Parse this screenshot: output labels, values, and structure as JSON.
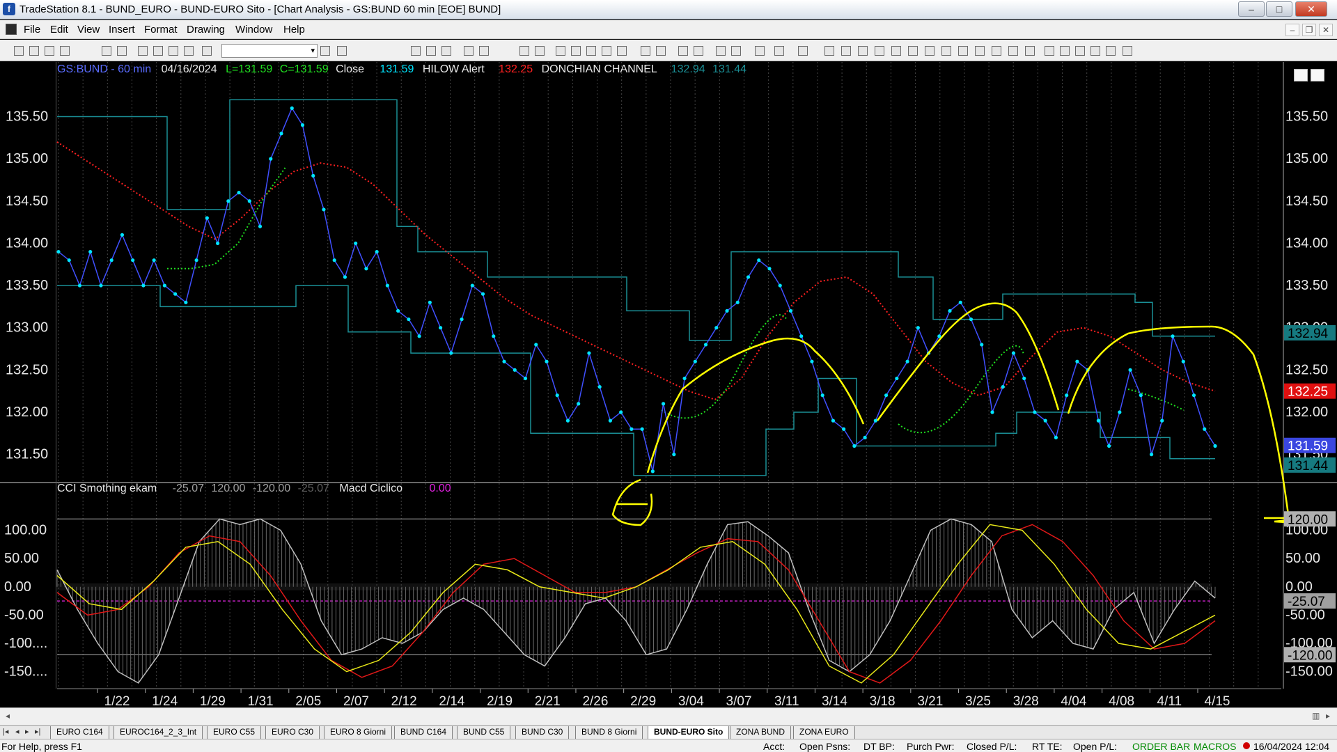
{
  "window": {
    "title": "TradeStation 8.1 - BUND_EURO - BUND-EURO Sito - [Chart Analysis - GS:BUND  60 min  [EOE] BUND]",
    "app_icon_letter": "f",
    "minimize": "–",
    "maximize": "□",
    "close": "✕"
  },
  "menu": {
    "items": [
      "File",
      "Edit",
      "View",
      "Insert",
      "Format",
      "Drawing",
      "Window",
      "Help"
    ],
    "mdi_minimize": "–",
    "mdi_restore": "❐",
    "mdi_close": "✕"
  },
  "toolbar": {
    "symbol_value": "",
    "dropdown_arrow": "▾"
  },
  "status_line": {
    "symbol": "GS:BUND - 60 min",
    "date": "04/16/2024",
    "low": "L=131.59",
    "close_val": "C=131.59",
    "close_label": "Close",
    "close_price": "131.59",
    "hilow_label": "HILOW Alert",
    "hilow_value": "132.25",
    "donchian_label": "DONCHIAN CHANNEL",
    "donchian_upper": "132.94",
    "donchian_lower": "131.44"
  },
  "sub_status": {
    "cci_label": "CCI Smothing ekam",
    "cci_value": "-25.07",
    "cci_upper": "120.00",
    "cci_lower": "-120.00",
    "cci_value2": "-25.07",
    "macd_label": "Macd Ciclico",
    "macd_value": "0.00"
  },
  "colors": {
    "price": "#00e5ff",
    "bar_line": "#4050ff",
    "sma": "#ff2020",
    "green_avg": "#20e020",
    "donchian": "#1a8f96",
    "drawing": "#ffff00",
    "cci": "#c0c0c0",
    "macd_red": "#e01818",
    "macd_yellow": "#e8e818"
  },
  "chart_data": [
    {
      "type": "line",
      "title": "",
      "y_ticks": [
        135.5,
        135.0,
        134.5,
        134.0,
        133.5,
        133.0,
        132.5,
        132.0,
        131.5
      ],
      "x_ticks": [
        "1/22",
        "1/24",
        "1/29",
        "1/31",
        "2/05",
        "2/07",
        "2/12",
        "2/14",
        "2/19",
        "2/21",
        "2/26",
        "2/29",
        "3/04",
        "3/07",
        "3/11",
        "3/14",
        "3/18",
        "3/21",
        "3/25",
        "3/28",
        "4/04",
        "4/08",
        "4/11",
        "4/15"
      ],
      "ylim": [
        131.2,
        135.9
      ],
      "series": [
        {
          "values": [
            133.9,
            133.8,
            133.5,
            133.9,
            133.5,
            133.8,
            134.1,
            133.8,
            133.5,
            133.8,
            133.5,
            133.4,
            133.3,
            133.8,
            134.3,
            134.0,
            134.5,
            134.6,
            134.5,
            134.2,
            135.0,
            135.3,
            135.6,
            135.4,
            134.8,
            134.4,
            133.8,
            133.6,
            134.0,
            133.7,
            133.9,
            133.5,
            133.2,
            133.1,
            132.9,
            133.3,
            133.0,
            132.7,
            133.1,
            133.5,
            133.4,
            132.9,
            132.6,
            132.5,
            132.4,
            132.8,
            132.6,
            132.2,
            131.9,
            132.1,
            132.7,
            132.3,
            131.9,
            132.0,
            131.8,
            131.8,
            131.3,
            132.1,
            131.5,
            132.4,
            132.6,
            132.8,
            133.0,
            133.2,
            133.3,
            133.6,
            133.8,
            133.7,
            133.5,
            133.2,
            132.9,
            132.6,
            132.2,
            131.9,
            131.8,
            131.6,
            131.7,
            131.9,
            132.2,
            132.4,
            132.6,
            133.0,
            132.7,
            132.9,
            133.2,
            133.3,
            133.1,
            132.8,
            132.0,
            132.3,
            132.7,
            132.4,
            132.0,
            131.9,
            131.7,
            132.2,
            132.6,
            132.5,
            131.9,
            131.6,
            132.0,
            132.5,
            132.2,
            131.5,
            131.9,
            132.9,
            132.6,
            132.2,
            131.8,
            131.6
          ],
          "name": ""
        },
        {
          "name": "",
          "values": [
            135.2,
            135.0,
            134.8,
            134.6,
            134.4,
            134.2,
            134.05,
            134.3,
            134.6,
            134.85,
            134.95,
            134.9,
            134.7,
            134.4,
            134.1,
            133.85,
            133.6,
            133.35,
            133.15,
            133.0,
            132.85,
            132.7,
            132.55,
            132.4,
            132.25,
            132.15,
            132.4,
            132.9,
            133.3,
            133.55,
            133.6,
            133.4,
            133.0,
            132.6,
            132.35,
            132.2,
            132.3,
            132.65,
            132.95,
            133.0,
            132.9,
            132.7,
            132.5,
            132.35,
            132.25
          ],
          "xrange": [
            0,
            1
          ]
        },
        {
          "name": "",
          "values": [
            133.7,
            133.7,
            133.75,
            134.0,
            134.5,
            134.9
          ],
          "xrange": [
            0.1,
            0.21
          ]
        }
      ],
      "donchian_upper_value": "132.94",
      "hilow_value": "132.25",
      "close_value": "131.59",
      "donchian_lower_value": "131.44",
      "ylabel": "",
      "xlabel": ""
    },
    {
      "type": "line",
      "title": "",
      "y_ticks": [
        "100.00",
        "50.00",
        "0.00",
        "-50.00",
        "-100....",
        "-150...."
      ],
      "ylim": [
        -180,
        140
      ],
      "levels": [
        120,
        -120
      ],
      "right_labels": {
        "upper": "120.00",
        "cci": "-25.07",
        "lower": "-120.00",
        "r100": "100.00",
        "r50": "50.00",
        "r0": "0.00",
        "rm50": "-50.00",
        "rm100": "-100.00",
        "rm150": "-150.00"
      },
      "series": [
        {
          "name": "",
          "values": [
            30,
            -40,
            -100,
            -150,
            -170,
            -120,
            -20,
            80,
            120,
            110,
            120,
            100,
            40,
            -60,
            -120,
            -110,
            -90,
            -100,
            -80,
            -40,
            -20,
            -40,
            -80,
            -120,
            -140,
            -90,
            -30,
            -20,
            -60,
            -120,
            -110,
            -40,
            40,
            110,
            115,
            90,
            60,
            -40,
            -130,
            -150,
            -120,
            -60,
            20,
            100,
            120,
            110,
            80,
            -40,
            -90,
            -60,
            -100,
            -110,
            -40,
            -10,
            -100,
            -40,
            10,
            -20
          ]
        },
        {
          "name": "",
          "values": [
            -10,
            -50,
            -40,
            0,
            60,
            90,
            80,
            20,
            -60,
            -130,
            -160,
            -140,
            -80,
            -10,
            40,
            50,
            20,
            -10,
            -10,
            0,
            30,
            60,
            85,
            80,
            30,
            -60,
            -150,
            -170,
            -130,
            -60,
            20,
            90,
            110,
            80,
            20,
            -60,
            -110,
            -100,
            -60
          ]
        },
        {
          "name": "",
          "values": [
            20,
            -30,
            -40,
            10,
            70,
            80,
            40,
            -40,
            -110,
            -150,
            -130,
            -80,
            -10,
            40,
            30,
            0,
            -10,
            -20,
            0,
            30,
            70,
            80,
            40,
            -40,
            -140,
            -170,
            -120,
            -40,
            40,
            110,
            100,
            40,
            -40,
            -100,
            -110,
            -80,
            -50
          ]
        }
      ]
    }
  ],
  "x_axis": [
    "1/22",
    "1/24",
    "1/29",
    "1/31",
    "2/05",
    "2/07",
    "2/12",
    "2/14",
    "2/19",
    "2/21",
    "2/26",
    "2/29",
    "3/04",
    "3/07",
    "3/11",
    "3/14",
    "3/18",
    "3/21",
    "3/25",
    "3/28",
    "4/04",
    "4/08",
    "4/11",
    "4/15"
  ],
  "tabs": {
    "items": [
      "EURO C164",
      "EUROC164_2_3_Int",
      "EURO C55",
      "EURO C30",
      "EURO 8 Giorni",
      "BUND C164",
      "BUND C55",
      "BUND  C30",
      "BUND 8 Giorni",
      "BUND-EURO Sito",
      "ZONA BUND",
      "ZONA EURO"
    ],
    "active": "BUND-EURO Sito"
  },
  "statusbar": {
    "help": "For Help, press F1",
    "acct": "Acct:",
    "open_psns": "Open Psns:",
    "dt_bp": "DT BP:",
    "purch_pwr": "Purch Pwr:",
    "closed_pl": "Closed P/L:",
    "rt_te": "RT TE:",
    "open_pl": "Open P/L:",
    "order_bar": "ORDER BAR",
    "macros": "MACROS",
    "datetime": "16/04/2024 12:04"
  }
}
